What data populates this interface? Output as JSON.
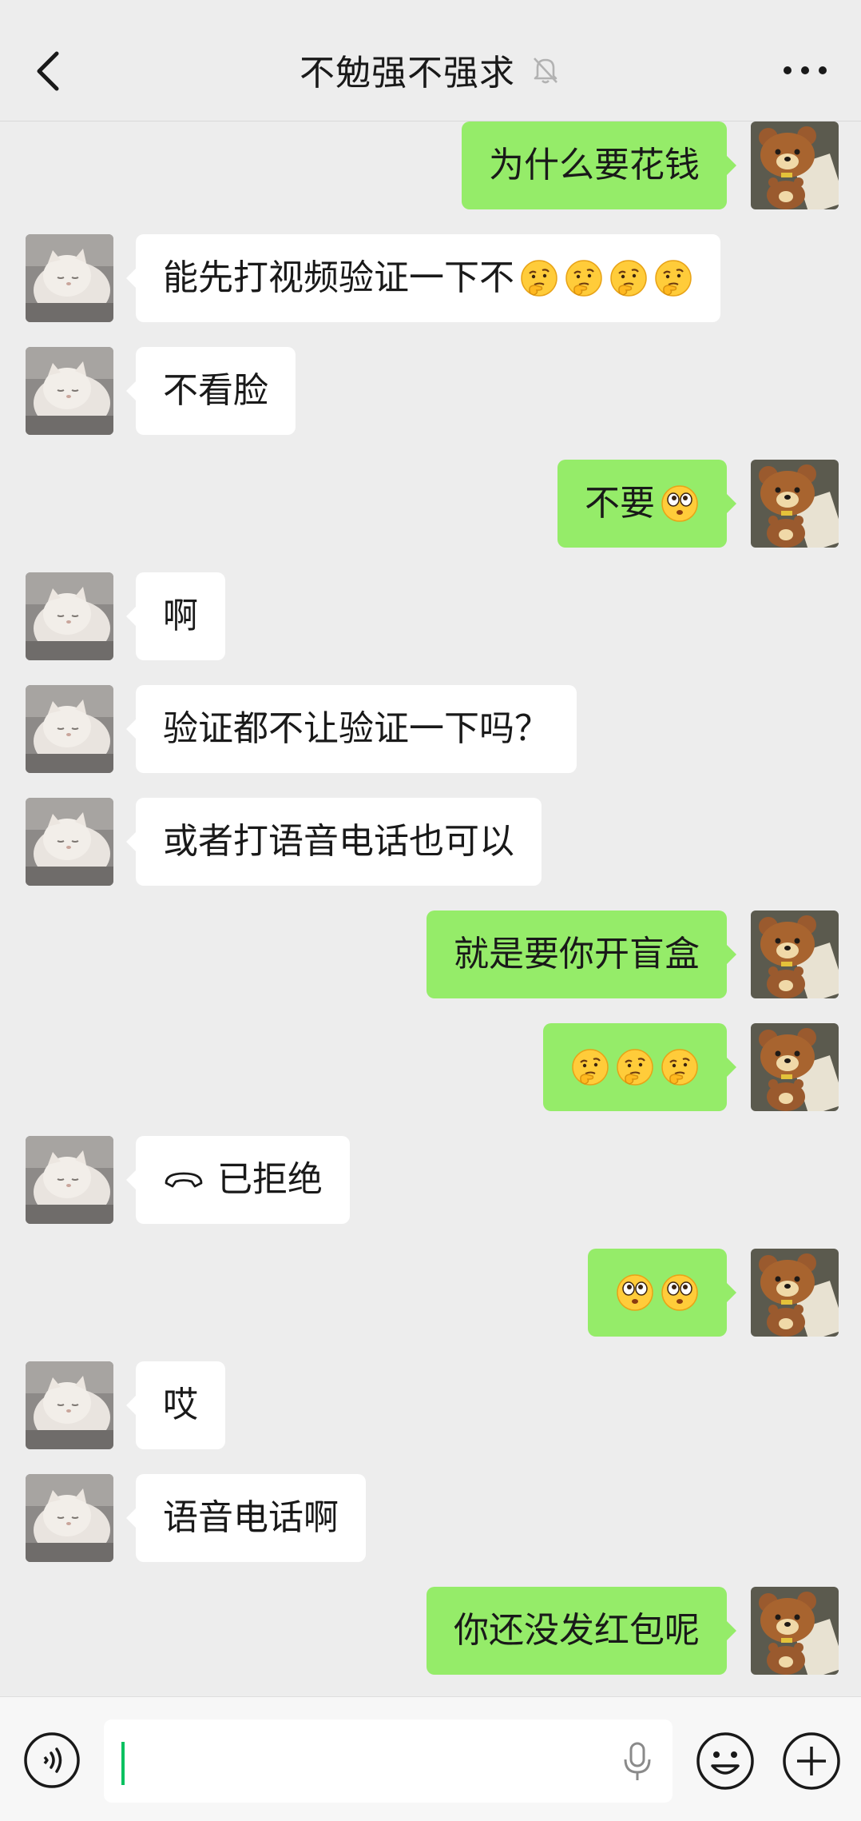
{
  "header": {
    "title": "不勉强不强求",
    "muted": true
  },
  "messages": [
    {
      "side": "right",
      "text": "为什么要花钱",
      "emojis": []
    },
    {
      "side": "left",
      "text": "能先打视频验证一下不",
      "emojis": [
        "thinking",
        "thinking",
        "thinking",
        "thinking"
      ]
    },
    {
      "side": "left",
      "text": "不看脸",
      "emojis": []
    },
    {
      "side": "right",
      "text": "不要",
      "emojis": [
        "surprised"
      ]
    },
    {
      "side": "left",
      "text": "啊",
      "emojis": []
    },
    {
      "side": "left",
      "text": "验证都不让验证一下吗？",
      "emojis": []
    },
    {
      "side": "left",
      "text": "或者打语音电话也可以",
      "emojis": []
    },
    {
      "side": "right",
      "text": "就是要你开盲盒",
      "emojis": []
    },
    {
      "side": "right",
      "text": "",
      "emojis": [
        "thinking",
        "thinking",
        "thinking"
      ]
    },
    {
      "side": "left",
      "text": "已拒绝",
      "call": true,
      "emojis": []
    },
    {
      "side": "right",
      "text": "",
      "emojis": [
        "surprised",
        "surprised"
      ]
    },
    {
      "side": "left",
      "text": "哎",
      "emojis": []
    },
    {
      "side": "left",
      "text": "语音电话啊",
      "emojis": []
    },
    {
      "side": "right",
      "text": "你还没发红包呢",
      "emojis": []
    }
  ],
  "input": {
    "value": ""
  },
  "colors": {
    "background": "#ededed",
    "my_bubble": "#95ec69",
    "their_bubble": "#ffffff",
    "caret": "#07c160"
  },
  "icons": [
    "back-arrow-icon",
    "mute-bell-icon",
    "more-icon",
    "voice-icon",
    "mic-icon",
    "emoji-icon",
    "plus-icon",
    "phone-hangup-icon"
  ]
}
